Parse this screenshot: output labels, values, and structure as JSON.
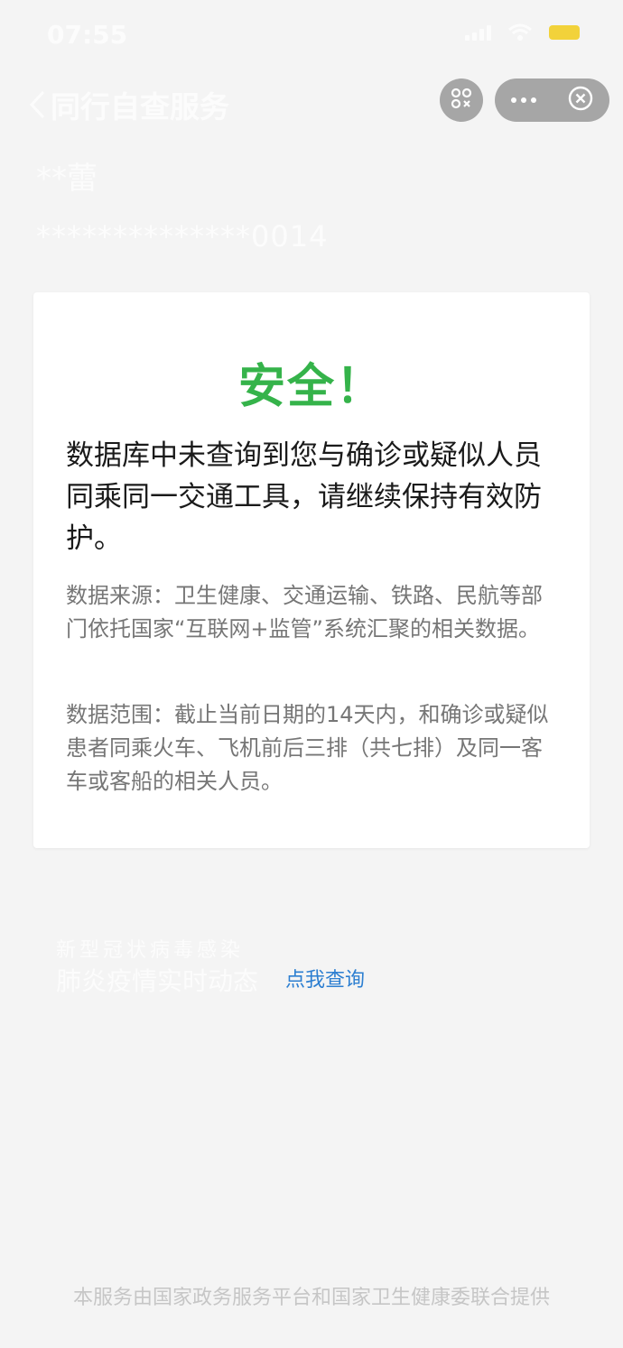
{
  "status_bar": {
    "time": "07:55"
  },
  "nav": {
    "title": "同行自查服务"
  },
  "user": {
    "name": "**蕾",
    "id_masked": "**************0014"
  },
  "card": {
    "title": "安全！",
    "main_text": "数据库中未查询到您与确诊或疑似人员同乘同一交通工具，请继续保持有效防护。",
    "source_text": "数据来源：卫生健康、交通运输、铁路、民航等部门依托国家“互联网+监管”系统汇聚的相关数据。",
    "range_text": "数据范围：截止当前日期的14天内，和确诊或疑似患者同乘火车、飞机前后三排（共七排）及同一客车或客船的相关人员。"
  },
  "tip": {
    "small": "新型冠状病毒感染",
    "main": "肺炎疫情实时动态",
    "link": "点我查询"
  },
  "footer": "本服务由国家政务服务平台和国家卫生健康委联合提供",
  "colors": {
    "safe_green": "#35b34a",
    "link_blue": "#2d7fd1",
    "background": "#f4f4f4"
  },
  "icons": [
    "chevron-left-icon",
    "scan-icon",
    "more-icon",
    "close-icon",
    "signal-icon",
    "wifi-icon",
    "battery-icon"
  ]
}
